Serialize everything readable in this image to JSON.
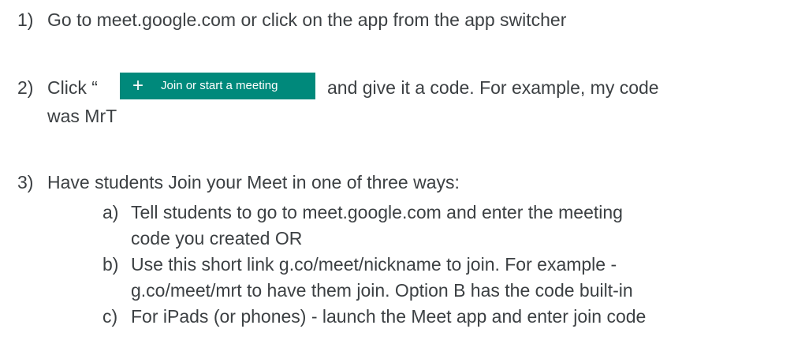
{
  "steps": {
    "s1": {
      "num": "1)",
      "text": "Go to meet.google.com or click on the app from the app switcher"
    },
    "s2": {
      "num": "2)",
      "prefix": "Click “",
      "button_plus": "+",
      "button_label": "Join or start a meeting",
      "suffix": "and give it a code. For example, my code",
      "cont": "was MrT"
    },
    "s3": {
      "num": "3)",
      "text": "Have students Join your Meet in one of three ways:",
      "a": {
        "label": "a)",
        "line1": "Tell students to go to meet.google.com and enter the meeting",
        "line2": "code you created OR"
      },
      "b": {
        "label": "b)",
        "line1": "Use this short link  g.co/meet/nickname to join. For example -",
        "line2": "g.co/meet/mrt to have them join.  Option B has the code built-in"
      },
      "c": {
        "label": "c)",
        "line1": "For iPads (or phones) - launch the Meet app and enter join code"
      }
    }
  }
}
